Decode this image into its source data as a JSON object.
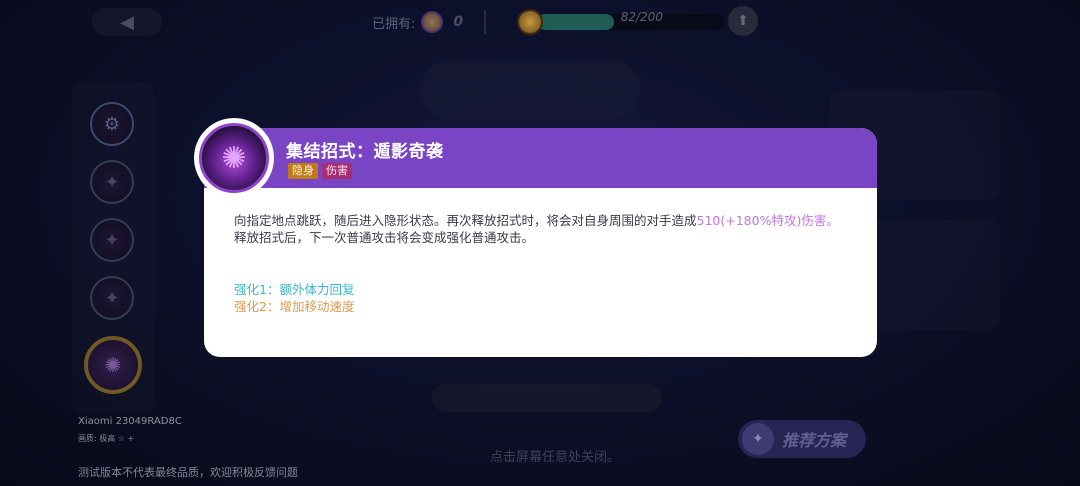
{
  "top_bar": {
    "owned_label": "已拥有:",
    "owned_count": "0",
    "progress_text": "82/200",
    "progress_value": 0.41
  },
  "skill_column": {
    "items": [
      {
        "name": "gear",
        "glyph": "⚙"
      },
      {
        "name": "skill-1",
        "glyph": "✦"
      },
      {
        "name": "skill-2",
        "glyph": "✦"
      },
      {
        "name": "skill-3",
        "glyph": "✦"
      },
      {
        "name": "skill-selected",
        "glyph": "✺"
      }
    ]
  },
  "popup": {
    "title": "集结招式：遁影奇袭",
    "tags": [
      "隐身",
      "伤害"
    ],
    "description_part1": "向指定地点跳跃，随后进入隐形状态。再次释放招式时，将会对自身周围的对手造成",
    "description_highlight": "510(+180%特攻)伤害。",
    "description_line2": "释放招式后，下一次普通攻击将会变成强化普通攻击。",
    "enhance1": "强化1：额外体力回复",
    "enhance2": "强化2：增加移动速度"
  },
  "footer": {
    "device": "Xiaomi 23049RAD8C",
    "quality": "画质: 极高 ☆ +",
    "disclaimer": "测试版本不代表最终品质，欢迎积极反馈问题",
    "close_hint": "点击屏幕任意处关闭。",
    "recommend_label": "推荐方案"
  },
  "colors": {
    "header_purple": "#7a45c5",
    "stealth_tag": "#c07a1e",
    "damage_tag": "#a52f72",
    "highlight": "#c178e2",
    "enhance1": "#3cb6c9",
    "enhance2": "#e39a4c"
  }
}
